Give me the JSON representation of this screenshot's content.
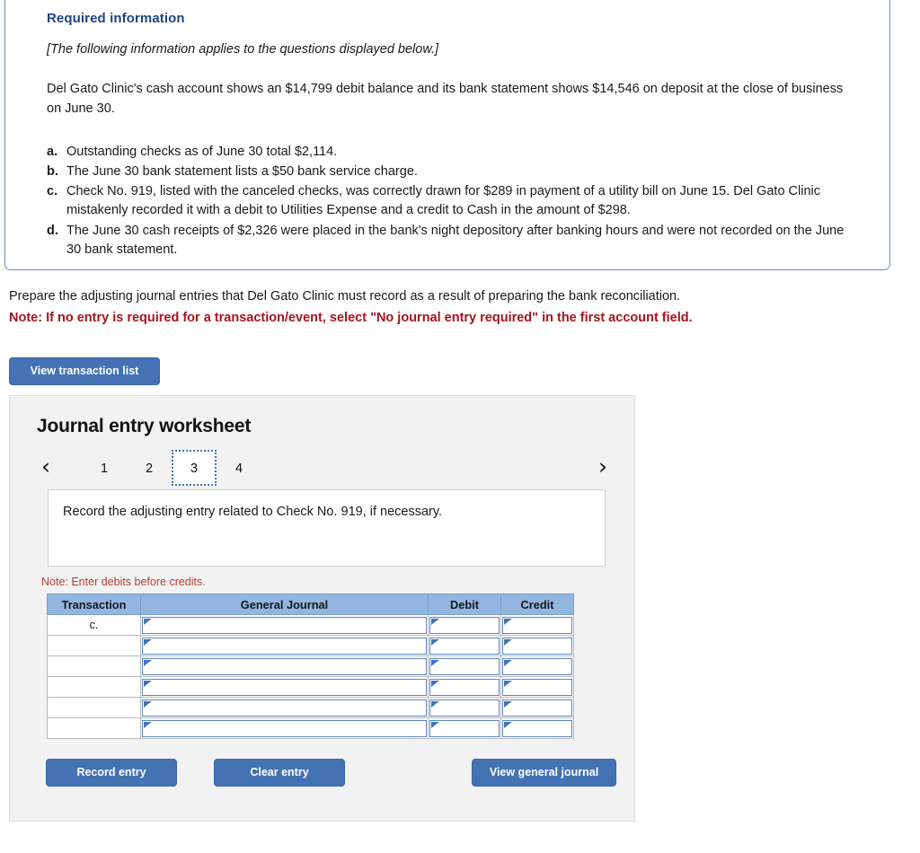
{
  "required_information": {
    "title": "Required information",
    "applies_note": "[The following information applies to the questions displayed below.]",
    "paragraph": "Del Gato Clinic's cash account shows an $14,799 debit balance and its bank statement shows $14,546 on deposit at the close of business on June 30.",
    "items": [
      {
        "marker": "a.",
        "text": "Outstanding checks as of June 30 total $2,114."
      },
      {
        "marker": "b.",
        "text": "The June 30 bank statement lists a $50 bank service charge."
      },
      {
        "marker": "c.",
        "text": "Check No. 919, listed with the canceled checks, was correctly drawn for $289 in payment of a utility bill on June 15. Del Gato Clinic mistakenly recorded it with a debit to Utilities Expense and a credit to Cash in the amount of $298."
      },
      {
        "marker": "d.",
        "text": "The June 30 cash receipts of $2,326 were placed in the bank's night depository after banking hours and were not recorded on the June 30 bank statement."
      }
    ]
  },
  "prompt": {
    "instruction": "Prepare the adjusting journal entries that Del Gato Clinic must record as a result of preparing the bank reconciliation.",
    "note": "Note: If no entry is required for a transaction/event, select \"No journal entry required\" in the first account field.",
    "view_transaction_list_label": "View transaction list"
  },
  "worksheet": {
    "title": "Journal entry worksheet",
    "prev_arrow": "‹",
    "next_arrow": "›",
    "tabs": [
      {
        "label": "1",
        "active": false
      },
      {
        "label": "2",
        "active": false
      },
      {
        "label": "3",
        "active": true
      },
      {
        "label": "4",
        "active": false
      }
    ],
    "active_tab": "3",
    "question": "Record the adjusting entry related to Check No. 919, if necessary.",
    "note": "Note: Enter debits before credits.",
    "table": {
      "headers": [
        "Transaction",
        "General Journal",
        "Debit",
        "Credit"
      ],
      "rows": [
        {
          "transaction": "c.",
          "general_journal": "",
          "debit": "",
          "credit": ""
        },
        {
          "transaction": "",
          "general_journal": "",
          "debit": "",
          "credit": ""
        },
        {
          "transaction": "",
          "general_journal": "",
          "debit": "",
          "credit": ""
        },
        {
          "transaction": "",
          "general_journal": "",
          "debit": "",
          "credit": ""
        },
        {
          "transaction": "",
          "general_journal": "",
          "debit": "",
          "credit": ""
        },
        {
          "transaction": "",
          "general_journal": "",
          "debit": "",
          "credit": ""
        }
      ]
    },
    "buttons": {
      "record_entry": "Record entry",
      "clear_entry": "Clear entry",
      "view_general_journal": "View general journal"
    }
  },
  "colors": {
    "button_blue": "#4472b4",
    "table_header_blue": "#93b6e0",
    "heading_blue": "#1c4587",
    "note_red": "#a8131b",
    "worksheet_bg": "#f2f2f2"
  }
}
